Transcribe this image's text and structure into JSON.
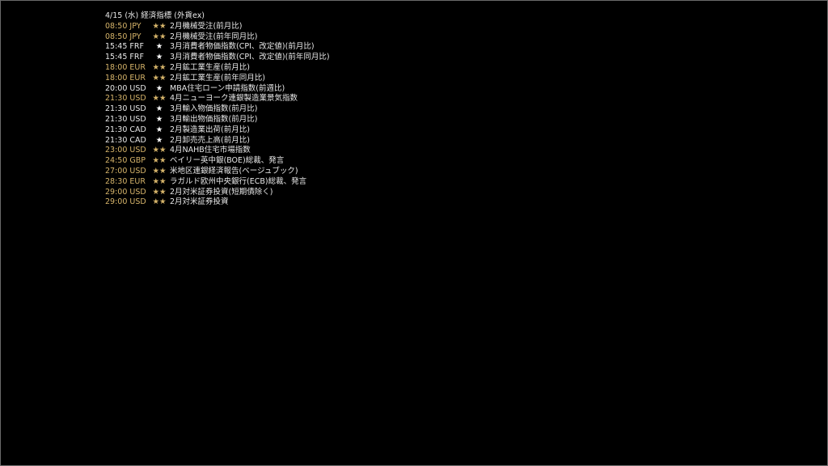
{
  "calendar": {
    "title": "4/15 (水) 経済指標 (外貨ex)",
    "highlight_color": "#d6b46a",
    "normal_color": "#e8e8e8",
    "rows": [
      {
        "time": "08:50 JPY",
        "stars": "★★",
        "event": "2月機械受注(前月比)",
        "level": "hi"
      },
      {
        "time": "08:50 JPY",
        "stars": "★★",
        "event": "2月機械受注(前年同月比)",
        "level": "hi"
      },
      {
        "time": "15:45 FRF",
        "stars": "★",
        "event": "3月消費者物価指数(CPI、改定値)(前月比)",
        "level": "lo"
      },
      {
        "time": "15:45 FRF",
        "stars": "★",
        "event": "3月消費者物価指数(CPI、改定値)(前年同月比)",
        "level": "lo"
      },
      {
        "time": "18:00 EUR",
        "stars": "★★",
        "event": "2月鉱工業生産(前月比)",
        "level": "hi"
      },
      {
        "time": "18:00 EUR",
        "stars": "★★",
        "event": "2月鉱工業生産(前年同月比)",
        "level": "hi"
      },
      {
        "time": "20:00 USD",
        "stars": "★",
        "event": "MBA住宅ローン申請指数(前週比)",
        "level": "lo"
      },
      {
        "time": "21:30 USD",
        "stars": "★★",
        "event": "4月ニューヨーク連銀製造業景気指数",
        "level": "hi"
      },
      {
        "time": "21:30 USD",
        "stars": "★",
        "event": "3月輸入物価指数(前月比)",
        "level": "lo"
      },
      {
        "time": "21:30 USD",
        "stars": "★",
        "event": "3月輸出物価指数(前月比)",
        "level": "lo"
      },
      {
        "time": "21:30 CAD",
        "stars": "★",
        "event": "2月製造業出荷(前月比)",
        "level": "lo"
      },
      {
        "time": "21:30 CAD",
        "stars": "★",
        "event": "2月卸売売上高(前月比)",
        "level": "lo"
      },
      {
        "time": "23:00 USD",
        "stars": "★★",
        "event": "4月NAHB住宅市場指数",
        "level": "hi"
      },
      {
        "time": "24:50 GBP",
        "stars": "★★",
        "event": "ベイリー英中銀(BOE)総裁、発言",
        "level": "hi"
      },
      {
        "time": "27:00 USD",
        "stars": "★★",
        "event": "米地区連銀経済報告(ベージュブック)",
        "level": "hi"
      },
      {
        "time": "28:30 EUR",
        "stars": "★★",
        "event": "ラガルド欧州中央銀行(ECB)総裁、発言",
        "level": "hi"
      },
      {
        "time": "29:00 USD",
        "stars": "★★",
        "event": "2月対米証券投資(短期債除く)",
        "level": "hi"
      },
      {
        "time": "29:00 USD",
        "stars": "★★",
        "event": "2月対米証券投資",
        "level": "hi"
      }
    ]
  }
}
